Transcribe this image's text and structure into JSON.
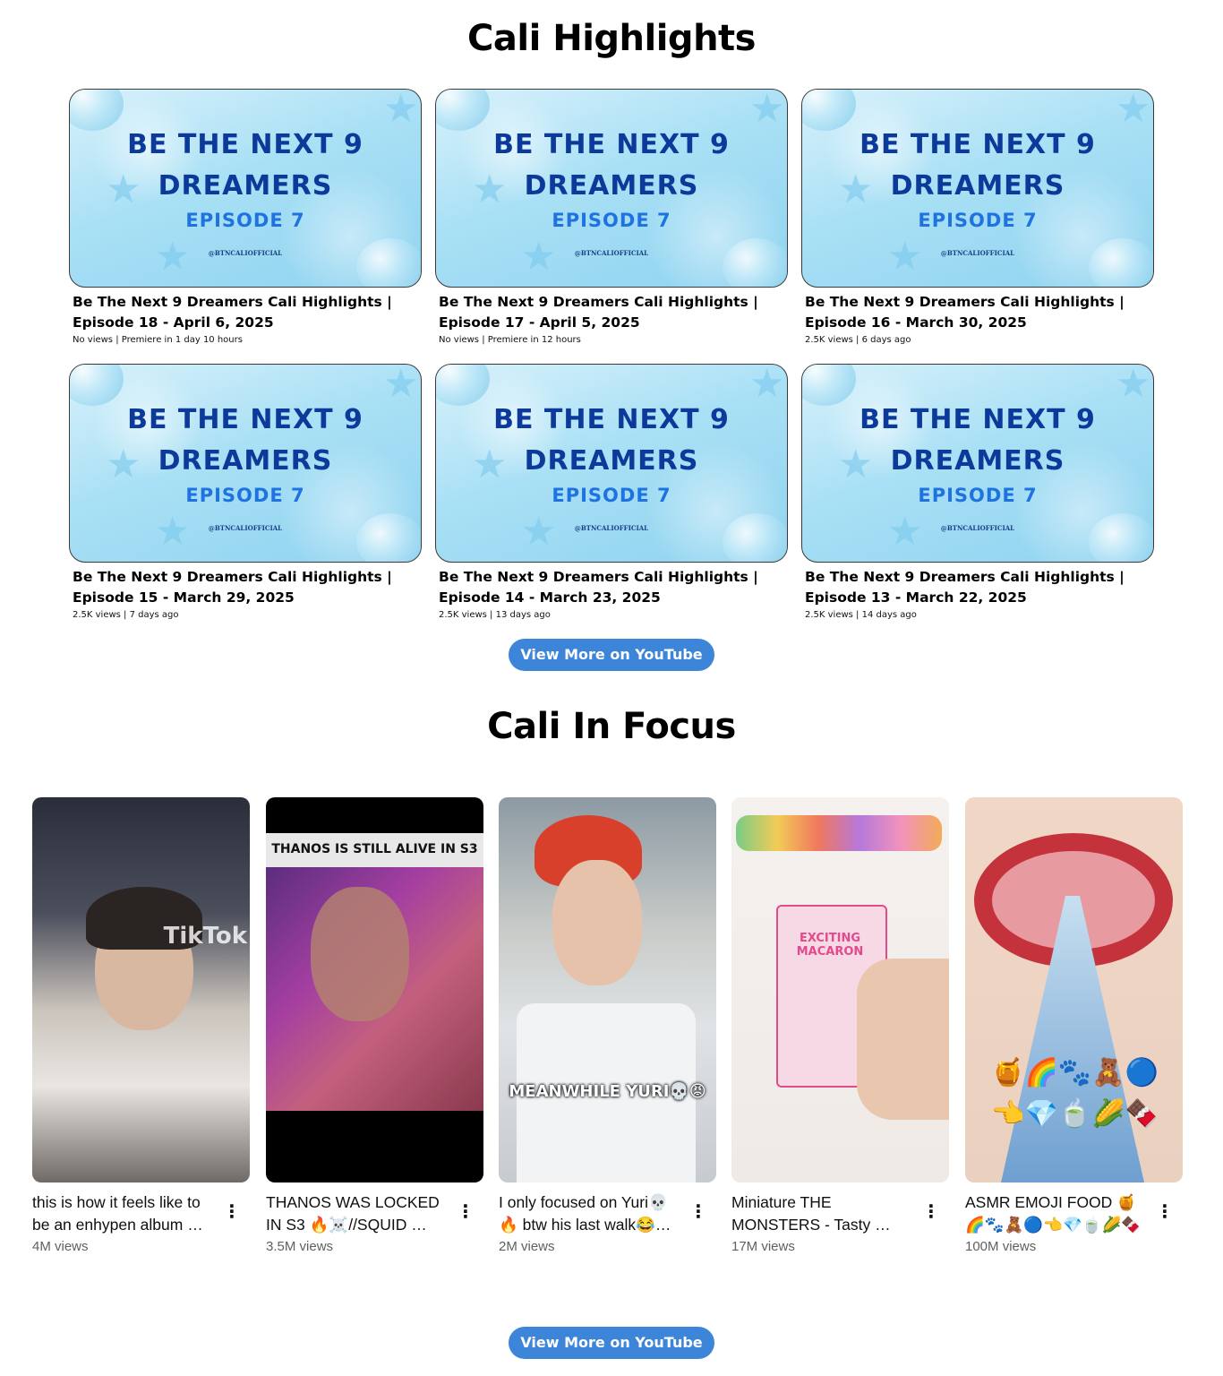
{
  "highlights": {
    "title": "Cali Highlights",
    "thumb": {
      "line1": "BE THE NEXT 9",
      "line2": "DREAMERS",
      "episode": "EPISODE 7",
      "handle": "@BTNCALIOFFICIAL"
    },
    "videos": [
      {
        "title": "Be The Next 9 Dreamers Cali Highlights | Episode 18 - April 6, 2025",
        "meta": "No views | Premiere in 1 day 10 hours"
      },
      {
        "title": "Be The Next 9 Dreamers Cali Highlights | Episode 17 - April 5, 2025",
        "meta": "No views | Premiere in 12 hours"
      },
      {
        "title": "Be The Next 9 Dreamers Cali Highlights | Episode 16 - March 30, 2025",
        "meta": "2.5K views | 6 days ago"
      },
      {
        "title": "Be The Next 9 Dreamers Cali Highlights | Episode 15 - March 29, 2025",
        "meta": "2.5K views | 7 days ago"
      },
      {
        "title": "Be The Next 9 Dreamers Cali Highlights | Episode 14 - March 23, 2025",
        "meta": "2.5K views | 13 days ago"
      },
      {
        "title": "Be The Next 9 Dreamers Cali Highlights | Episode 13 - March 22, 2025",
        "meta": "2.5K views | 14 days ago"
      }
    ],
    "button_label": "View More on YouTube"
  },
  "focus": {
    "title": "Cali In Focus",
    "shorts": [
      {
        "title": "this is how it feels like to be an enhypen album …",
        "views": "4M views",
        "overlay": "TikTok"
      },
      {
        "title": "THANOS WAS LOCKED IN S3 🔥☠️//SQUID …",
        "views": "3.5M views",
        "overlay": "THANOS IS STILL ALIVE IN S3"
      },
      {
        "title": "I only focused on Yuri💀🔥 btw his last walk😂…",
        "views": "2M views",
        "overlay": "MEANWHILE YURI💀😡"
      },
      {
        "title": "Miniature THE MONSTERS - Tasty …",
        "views": "17M views",
        "overlay": "EXCITING MACARON"
      },
      {
        "title": "ASMR EMOJI FOOD 🍯🌈🐾🧸🔵👈💎🍵🌽🍫 이모…",
        "views": "100M views",
        "overlay": "🍯🌈🐾🧸🔵 👈💎🍵🌽🍫"
      }
    ],
    "button_label": "View More on YouTube"
  }
}
